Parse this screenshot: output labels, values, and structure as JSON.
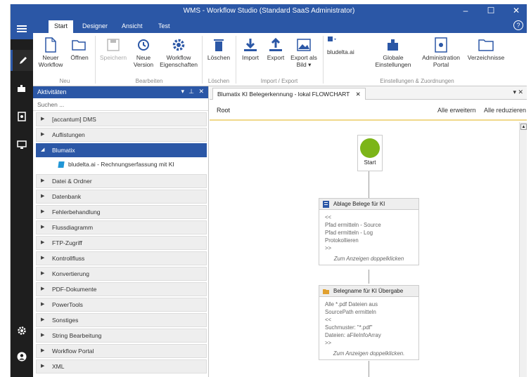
{
  "window": {
    "title": "WMS - Workflow Studio (Standard SaaS Administrator)",
    "min_glyph": "‒",
    "max_glyph": "☐",
    "close_glyph": "✕"
  },
  "nav": {
    "items": [
      "menu-icon",
      "pencil-icon",
      "puzzle-icon",
      "document-gear-icon",
      "monitor-icon"
    ],
    "bottom": [
      "gear-icon",
      "user-icon"
    ]
  },
  "ribbon_tabs": [
    "Start",
    "Designer",
    "Ansicht",
    "Test"
  ],
  "ribbon": {
    "neu": "Neuer Workflow",
    "oeffnen": "Öffnen",
    "speichern": "Speichern",
    "neue_version": "Neue Version",
    "workflow_eigenschaften": "Workflow Eigenschaften",
    "loeschen": "Löschen",
    "import": "Import",
    "export": "Export",
    "export_bild": "Export als Bild ▾",
    "bludelta": "bludelta.ai",
    "globale": "Globale Einstellungen",
    "admin_portal": "Administration Portal",
    "verzeichnisse": "Verzeichnisse",
    "groups": [
      "Neu",
      "Bearbeiten",
      "Löschen",
      "Import / Export",
      "Einstellungen & Zuordnungen"
    ]
  },
  "left_panel": {
    "title": "Aktivitäten",
    "search_placeholder": "Suchen ...",
    "categories": [
      "[accantum] DMS",
      "Auflistungen",
      "Blumatix",
      "Datei & Ordner",
      "Datenbank",
      "Fehlerbehandlung",
      "Flussdiagramm",
      "FTP-Zugriff",
      "Kontrollfluss",
      "Konvertierung",
      "PDF-Dokumente",
      "PowerTools",
      "Sonstiges",
      "String Bearbeitung",
      "Workflow Portal",
      "XML"
    ],
    "expanded_child": "bludelta.ai - Rechnungserfassung mit KI"
  },
  "document": {
    "tab_title": "Blumatix KI Belegerkennung - lokal FLOWCHART",
    "breadcrumb": "Root",
    "expand_all": "Alle erweitern",
    "collapse_all": "Alle reduzieren"
  },
  "flow": {
    "start_label": "Start",
    "node1": {
      "title": "Ablage Belege für KI",
      "lines": [
        "<<",
        "Pfad ermitteln - Source",
        "Pfad ermitteln - Log",
        "Protokollieren",
        ">>"
      ],
      "footer": "Zum Anzeigen doppelklicken"
    },
    "node2": {
      "title": "Belegname für KI Übergabe",
      "lines": [
        "Alle *.pdf Dateien aus",
        "SourcePath ermitteln",
        "<<",
        "Suchmuster: \"*.pdf\"",
        "Dateien: aFileInfoArray",
        ">>"
      ],
      "footer": "Zum Anzeigen doppelklicken."
    }
  },
  "colors": {
    "accent": "#2b57a6",
    "start": "#7cb518",
    "nav": "#1e1e1e"
  }
}
